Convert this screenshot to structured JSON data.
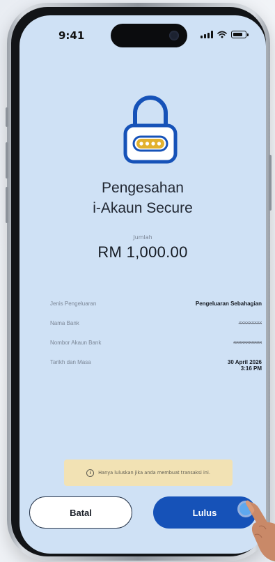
{
  "status_bar": {
    "time": "9:41"
  },
  "header": {
    "title_line1": "Pengesahan",
    "title_line2": "i-Akaun Secure"
  },
  "amount": {
    "label": "Jumlah",
    "value": "RM 1,000.00"
  },
  "details": [
    {
      "label": "Jenis Pengeluaran",
      "value": "Pengeluaran Sebahagian"
    },
    {
      "label": "Nama Bank",
      "value": "xxxxxxxxx"
    },
    {
      "label": "Nombor Akaun Bank",
      "value": "xxxxxxxxxxx"
    },
    {
      "label": "Tarikh dan Masa",
      "value": "30 April 2026",
      "value2": "3:16 PM"
    }
  ],
  "notice": {
    "text": "Hanya luluskan jika anda membuat transaksi ini."
  },
  "buttons": {
    "cancel": "Batal",
    "approve": "Lulus"
  },
  "colors": {
    "screen_bg": "#cfe1f5",
    "primary": "#1652b8",
    "notice_bg": "#f2e2b4",
    "lock_outline": "#1652b8",
    "lock_accent": "#e2b12f"
  },
  "icons": [
    "padlock-icon",
    "info-icon",
    "signal-icon",
    "wifi-icon",
    "battery-icon"
  ]
}
